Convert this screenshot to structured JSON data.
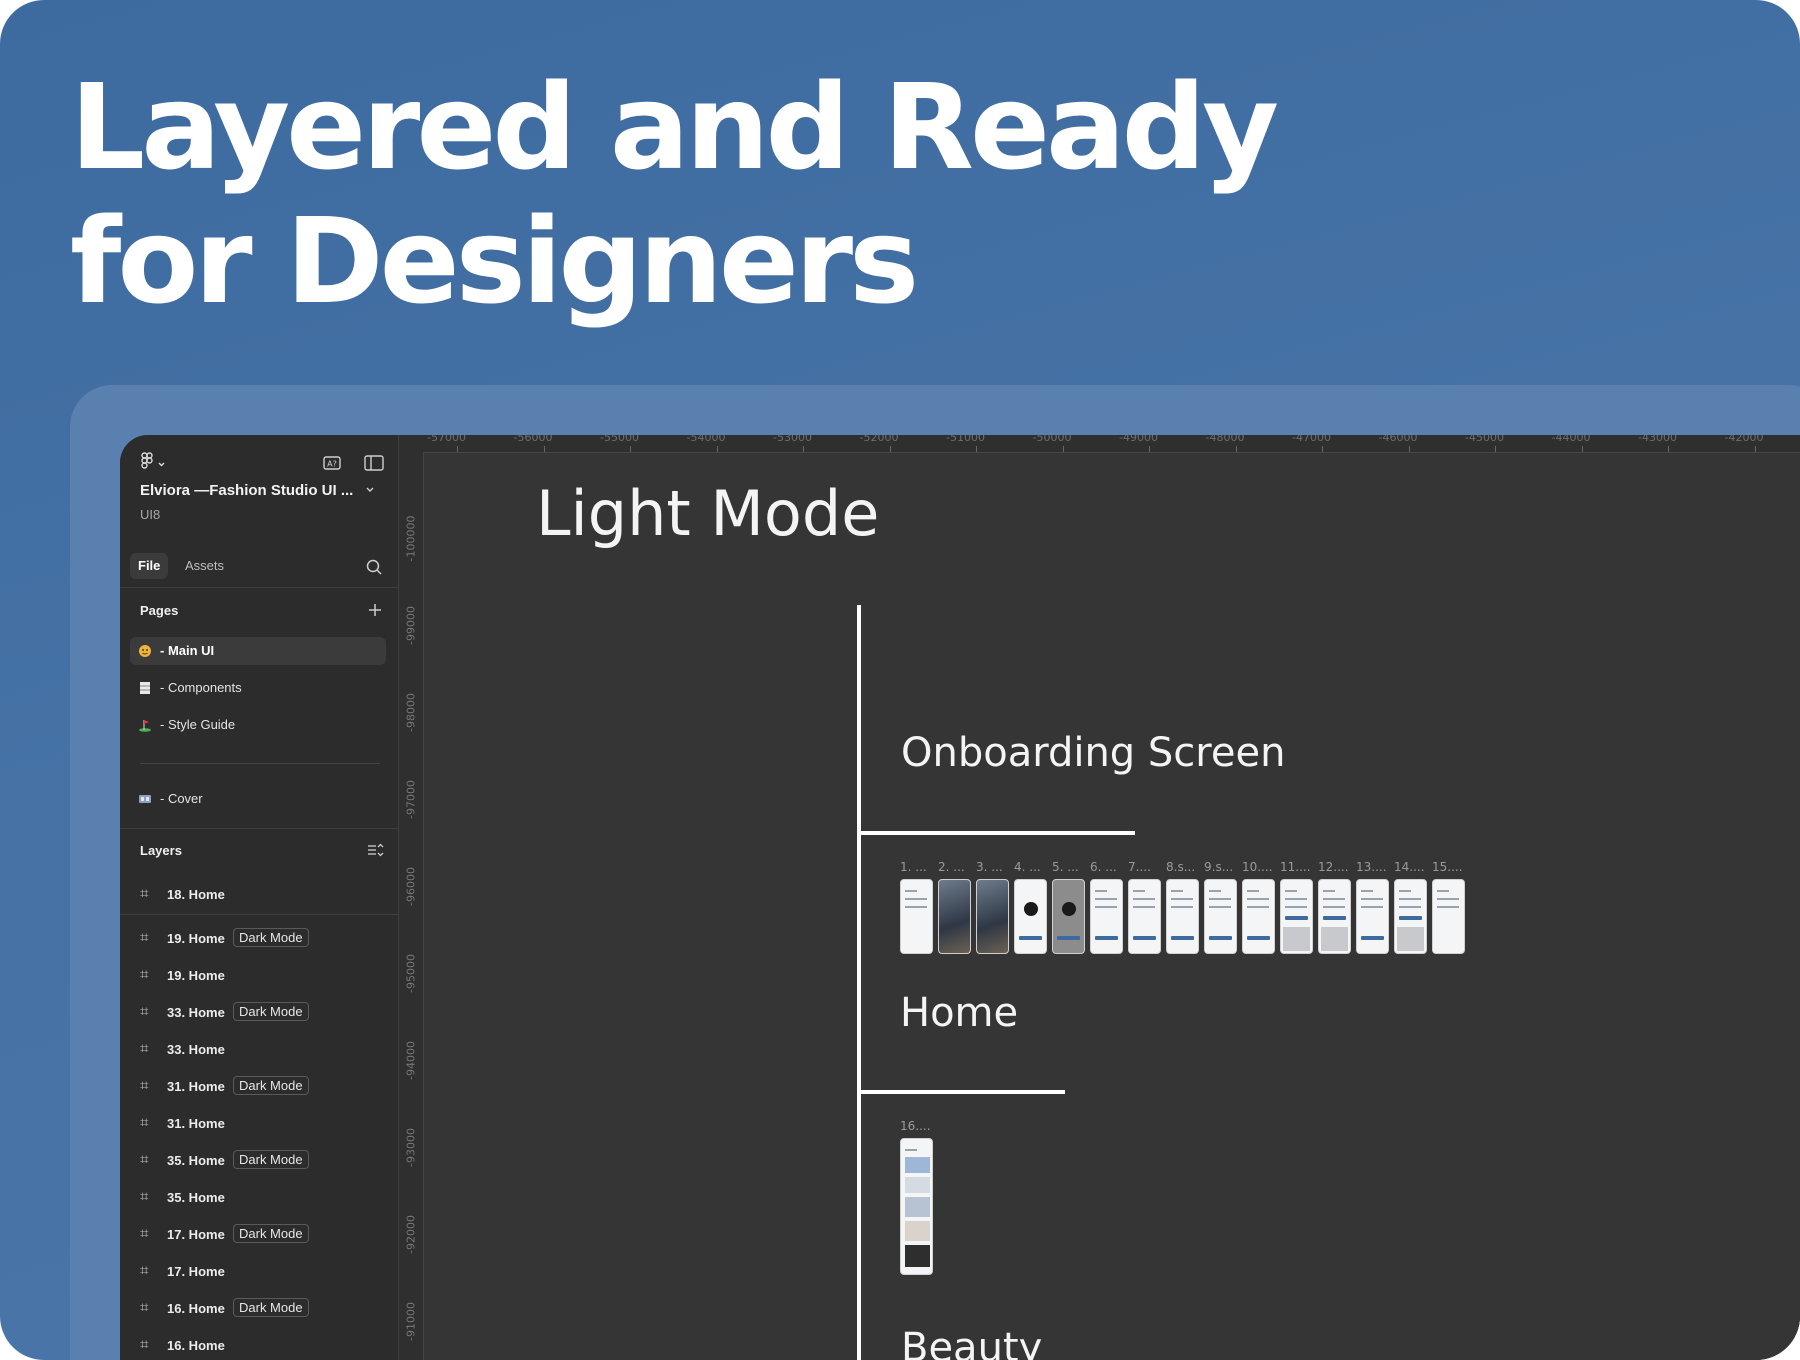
{
  "headline": {
    "line1": "Layered and Ready",
    "line2": "for Designers"
  },
  "colors": {
    "background": "#4672a6",
    "panel": "#2c2c2c",
    "canvas": "#353535",
    "accent": "#3f6aa0",
    "text": "#ffffff"
  },
  "sidebar": {
    "project_title": "Elviora —Fashion Studio UI ...",
    "project_subtitle": "UI8",
    "tabs": [
      {
        "label": "File",
        "active": true
      },
      {
        "label": "Assets",
        "active": false
      }
    ],
    "pages_label": "Pages",
    "pages": [
      {
        "label": "- Main UI",
        "icon": "emoji-face-icon",
        "active": true
      },
      {
        "label": "- Components",
        "icon": "document-icon",
        "active": false
      },
      {
        "label": "- Style Guide",
        "icon": "flag-icon",
        "active": false
      },
      {
        "label": "- Cover",
        "icon": "film-icon",
        "active": false
      }
    ],
    "layers_label": "Layers",
    "layers": [
      {
        "name": "18. Home",
        "tag": ""
      },
      {
        "name": "19. Home",
        "tag": "Dark Mode"
      },
      {
        "name": "19. Home",
        "tag": ""
      },
      {
        "name": "33. Home",
        "tag": "Dark Mode"
      },
      {
        "name": "33. Home",
        "tag": ""
      },
      {
        "name": "31. Home",
        "tag": "Dark Mode"
      },
      {
        "name": "31. Home",
        "tag": ""
      },
      {
        "name": "35. Home",
        "tag": "Dark Mode"
      },
      {
        "name": "35. Home",
        "tag": ""
      },
      {
        "name": "17. Home",
        "tag": "Dark Mode"
      },
      {
        "name": "17. Home",
        "tag": ""
      },
      {
        "name": "16. Home",
        "tag": "Dark Mode"
      },
      {
        "name": "16. Home",
        "tag": ""
      }
    ]
  },
  "rulers": {
    "top": [
      "-57000",
      "-56000",
      "-55000",
      "-54000",
      "-53000",
      "-52000",
      "-51000",
      "-50000",
      "-49000",
      "-48000",
      "-47000",
      "-46000",
      "-45000",
      "-44000",
      "-43000",
      "-42000"
    ],
    "left": [
      "-100000",
      "-99000",
      "-98000",
      "-97000",
      "-96000",
      "-95000",
      "-94000",
      "-93000",
      "-92000",
      "-91000"
    ]
  },
  "canvas": {
    "section_title": "Light Mode",
    "groups": [
      {
        "title": "Onboarding Screen"
      },
      {
        "title": "Home"
      },
      {
        "title": "Beauty"
      }
    ],
    "onboarding_frames": [
      "1. ...",
      "2. ...",
      "3. ...",
      "4. ...",
      "5. ...",
      "6. ...",
      "7....",
      "8.s...",
      "9.s...",
      "10....",
      "11....",
      "12....",
      "13....",
      "14....",
      "15...."
    ],
    "home_frames": [
      "16...."
    ]
  }
}
